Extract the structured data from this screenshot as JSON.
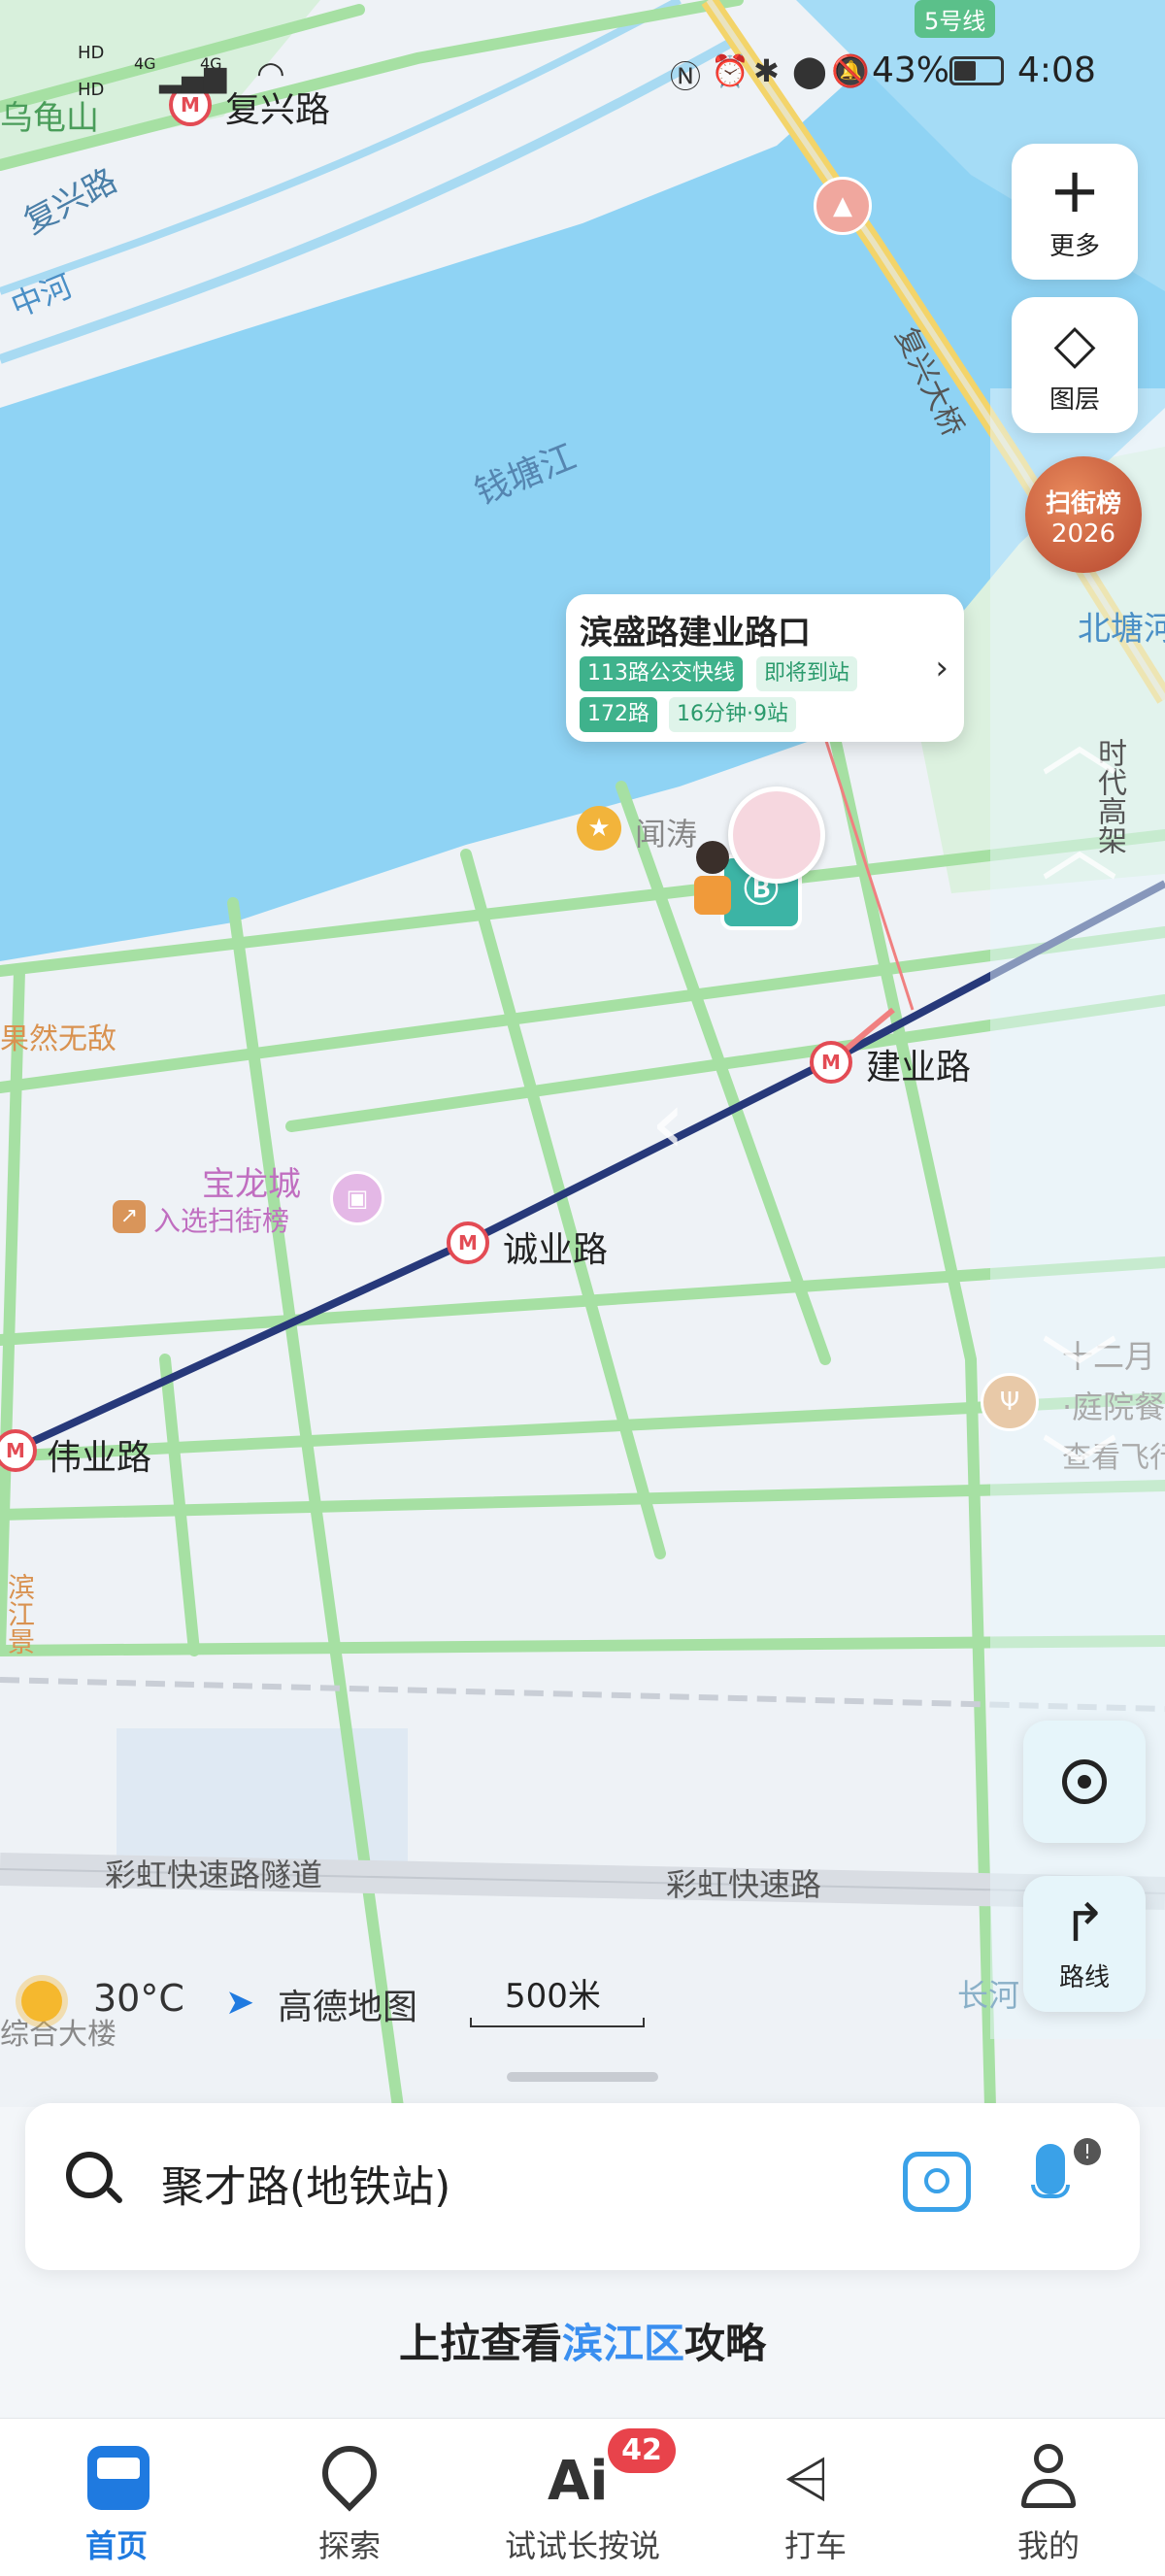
{
  "status_bar": {
    "net_labels": [
      "HD",
      "4G",
      "4G",
      "HD"
    ],
    "battery": "43%",
    "time": "4:08"
  },
  "map": {
    "river_name": "钱塘江",
    "map_labels": {
      "fuxing_bridge": "复兴大桥",
      "north_tang": "北塘河",
      "zhonghe": "中河",
      "fuxing_road_diag": "复兴路",
      "wuguishan": "乌龟山",
      "guoran": "果然无敌",
      "baolong": "宝龙城",
      "baolong_sub": "入选扫街榜",
      "wentao": "闻涛",
      "shidai": "时代高架",
      "rainbow_tunnel": "彩虹快速路隧道",
      "rainbow_road": "彩虹快速路",
      "changhe": "长河",
      "zongtai": "综合大楼",
      "right_poi_1": "十二月",
      "right_poi_2": "·庭院餐",
      "right_poi_3": "查看飞行",
      "left_poi": "滨江景",
      "line5": "5号线"
    },
    "stations": {
      "fuxing": "复兴路",
      "jianye": "建业路",
      "chengye": "诚业路",
      "weiye": "伟业路"
    },
    "weather": {
      "temp": "30°C"
    },
    "brand": "高德地图",
    "scale": "500米"
  },
  "bus_card": {
    "stop_name": "滨盛路建业路口",
    "routes": [
      {
        "route": "113路公交快线",
        "status": "即将到站"
      },
      {
        "route": "172路",
        "status": "16分钟·9站"
      }
    ]
  },
  "controls": {
    "more": "更多",
    "layers": "图层",
    "rank_badge_1": "扫街榜",
    "rank_badge_2": "2026",
    "route": "路线"
  },
  "search": {
    "value": "聚才路(地铁站)"
  },
  "promo": {
    "prefix": "上拉查看",
    "highlight": "滨江区",
    "suffix": "攻略"
  },
  "tabs": [
    {
      "label": "首页",
      "active": true
    },
    {
      "label": "探索",
      "active": false
    },
    {
      "label": "试试长按说",
      "active": false,
      "badge": "42"
    },
    {
      "label": "打车",
      "active": false
    },
    {
      "label": "我的",
      "active": false
    }
  ],
  "colors": {
    "accent": "#1f7ae0",
    "river": "#8fd3f4",
    "road": "#9fdc9a",
    "metro_line": "#27397a",
    "badge": "#e8434b"
  }
}
